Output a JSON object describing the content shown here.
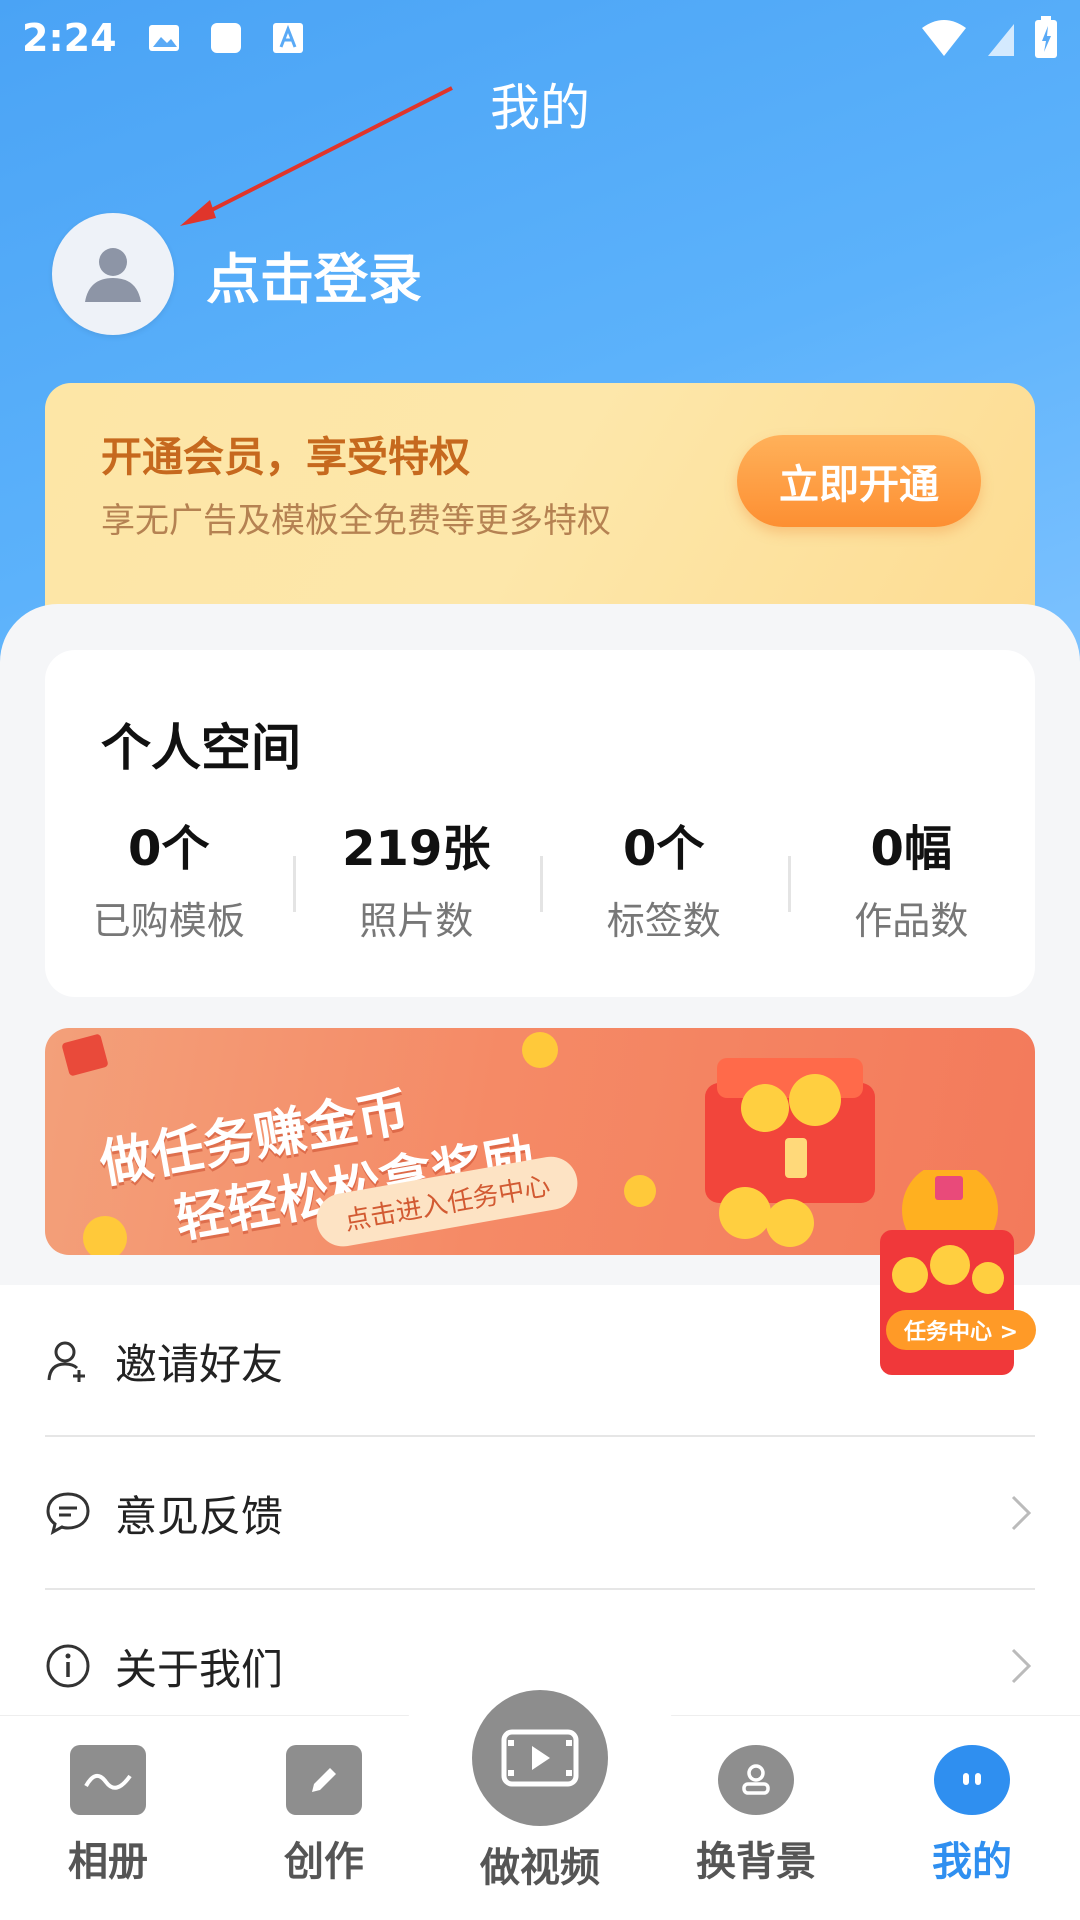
{
  "status_bar": {
    "time": "2:24"
  },
  "header": {
    "title": "我的"
  },
  "profile": {
    "login_label": "点击登录"
  },
  "vip": {
    "title": "开通会员，享受特权",
    "subtitle": "享无广告及模板全免费等更多特权",
    "button_label": "立即开通",
    "accent_color": "#fd8f32"
  },
  "personal_space": {
    "title": "个人空间",
    "stats": [
      {
        "value": "0个",
        "label": "已购模板"
      },
      {
        "value": "219张",
        "label": "照片数"
      },
      {
        "value": "0个",
        "label": "标签数"
      },
      {
        "value": "0幅",
        "label": "作品数"
      }
    ]
  },
  "task_banner": {
    "line1": "做任务赚金币",
    "line2": "轻轻松松拿奖励",
    "cta": "点击进入任务中心"
  },
  "task_float": {
    "label": "任务中心 >"
  },
  "menu": [
    {
      "label": "邀请好友",
      "icon": "add-user-icon"
    },
    {
      "label": "意见反馈",
      "icon": "chat-icon"
    },
    {
      "label": "关于我们",
      "icon": "info-icon"
    }
  ],
  "tabs": [
    {
      "label": "相册",
      "icon": "album-icon"
    },
    {
      "label": "创作",
      "icon": "pencil-icon"
    },
    {
      "label": "做视频",
      "icon": "video-icon"
    },
    {
      "label": "换背景",
      "icon": "person-icon"
    },
    {
      "label": "我的",
      "icon": "mine-icon",
      "active": true
    }
  ],
  "colors": {
    "primary": "#4aa3f5",
    "active_tab": "#2f8ff0"
  }
}
